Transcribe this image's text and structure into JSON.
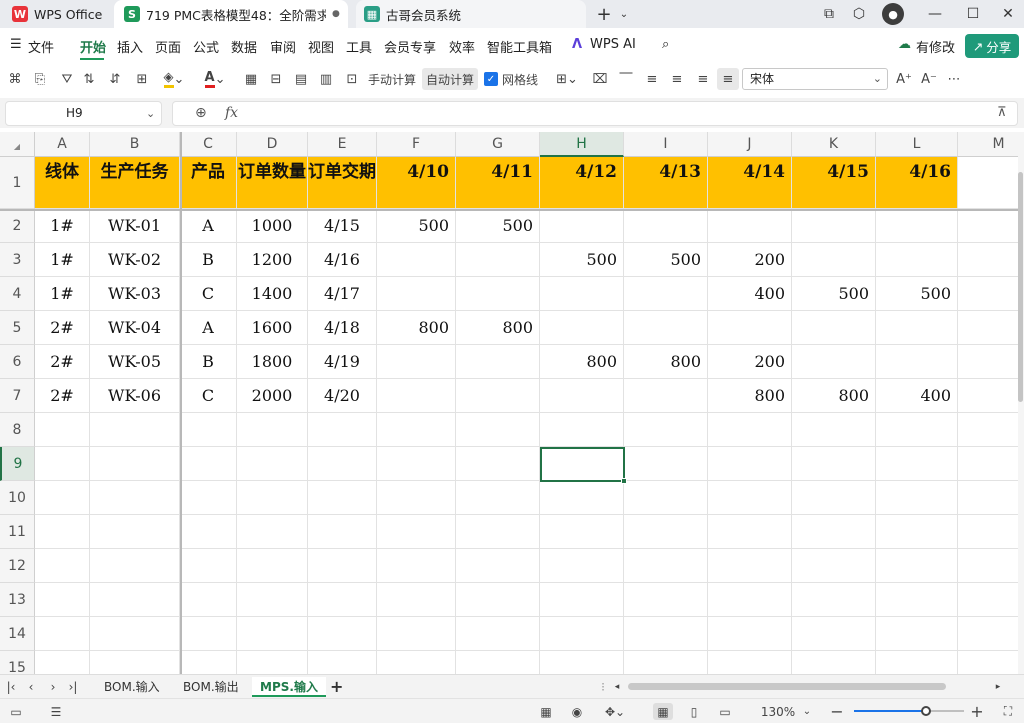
{
  "window": {
    "tabs": [
      {
        "label": "WPS Office",
        "icon": "wps-logo-icon"
      },
      {
        "label": "719 PMC表格模型48：全阶需求",
        "icon": "spreadsheet-icon"
      },
      {
        "label": "古哥会员系统",
        "icon": "app-icon"
      }
    ],
    "new_tab": "+"
  },
  "menu": {
    "file": "文件",
    "items": [
      "开始",
      "插入",
      "页面",
      "公式",
      "数据",
      "审阅",
      "视图",
      "工具",
      "会员专享",
      "效率",
      "智能工具箱"
    ],
    "wps_ai": "WPS AI",
    "modified": "有修改",
    "share": "分享"
  },
  "toolbar": {
    "manual_calc": "手动计算",
    "auto_calc": "自动计算",
    "gridlines": "网格线",
    "font_name": "宋体"
  },
  "formula_bar": {
    "cell_ref": "H9",
    "fx": "fx",
    "content": ""
  },
  "sheet": {
    "columns": [
      "A",
      "B",
      "C",
      "D",
      "E",
      "F",
      "G",
      "H",
      "I",
      "J",
      "K",
      "L",
      "M"
    ],
    "rows": [
      "1",
      "2",
      "3",
      "4",
      "5",
      "6",
      "7",
      "8",
      "9",
      "10",
      "11",
      "12",
      "13",
      "14",
      "15"
    ],
    "header": [
      "线体",
      "生产任务",
      "产品",
      "订单数量",
      "订单交期",
      "4/10",
      "4/11",
      "4/12",
      "4/13",
      "4/14",
      "4/15",
      "4/16"
    ],
    "data": [
      [
        "1#",
        "WK-01",
        "A",
        "1000",
        "4/15",
        "500",
        "500",
        "",
        "",
        "",
        "",
        ""
      ],
      [
        "1#",
        "WK-02",
        "B",
        "1200",
        "4/16",
        "",
        "",
        "500",
        "500",
        "200",
        "",
        ""
      ],
      [
        "1#",
        "WK-03",
        "C",
        "1400",
        "4/17",
        "",
        "",
        "",
        "",
        "400",
        "500",
        "500"
      ],
      [
        "2#",
        "WK-04",
        "A",
        "1600",
        "4/18",
        "800",
        "800",
        "",
        "",
        "",
        "",
        ""
      ],
      [
        "2#",
        "WK-05",
        "B",
        "1800",
        "4/19",
        "",
        "",
        "800",
        "800",
        "200",
        "",
        ""
      ],
      [
        "2#",
        "WK-06",
        "C",
        "2000",
        "4/20",
        "",
        "",
        "",
        "",
        "800",
        "800",
        "400"
      ]
    ],
    "header_color": "#ffc000",
    "selected_cell": "H9"
  },
  "sheet_tabs": {
    "tabs": [
      "BOM.输入",
      "BOM.输出",
      "MPS.输入"
    ],
    "active": "MPS.输入",
    "add": "+"
  },
  "status": {
    "zoom": "130%",
    "zoom_level": 0.65
  },
  "colors": {
    "accent": "#1f9a5a",
    "selection": "#217346"
  }
}
